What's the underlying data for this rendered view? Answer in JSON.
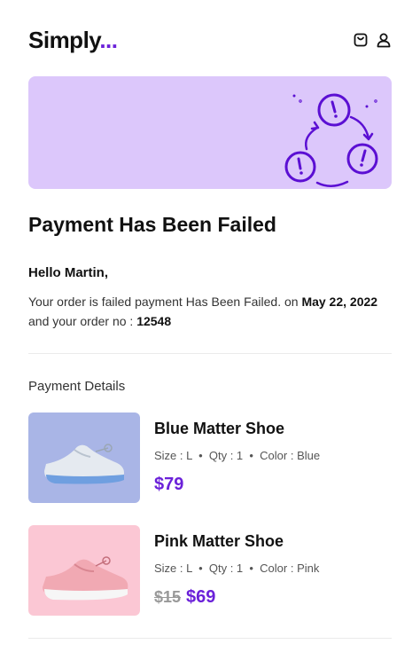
{
  "header": {
    "logo_text": "Simply",
    "logo_dots": "...",
    "icons": [
      "shopping-bag-icon",
      "user-icon"
    ]
  },
  "banner": {
    "illustration": "payment-failed-cycle-illustration",
    "bg_color": "#dcc7fb"
  },
  "email": {
    "title": "Payment Has Been Failed",
    "greeting": "Hello Martin,",
    "message_part1": "Your order is failed payment Has Been Failed. on ",
    "date": "May 22, 2022",
    "message_part2": "and your order no : ",
    "order_no": "12548"
  },
  "payment_details": {
    "title": "Payment Details",
    "products": [
      {
        "name": "Blue Matter Shoe",
        "size": "Size : L",
        "qty": "Qty : 1",
        "color": "Color : Blue",
        "price": "$79",
        "old_price": ""
      },
      {
        "name": "Pink Matter Shoe",
        "size": "Size : L",
        "qty": "Qty : 1",
        "color": "Color : Pink",
        "price": "$69",
        "old_price": "$15"
      }
    ]
  },
  "colors": {
    "accent": "#6b21d9",
    "banner": "#dcc7fb",
    "product1_bg": "#a9b5e6",
    "product2_bg": "#fbc7d4"
  }
}
